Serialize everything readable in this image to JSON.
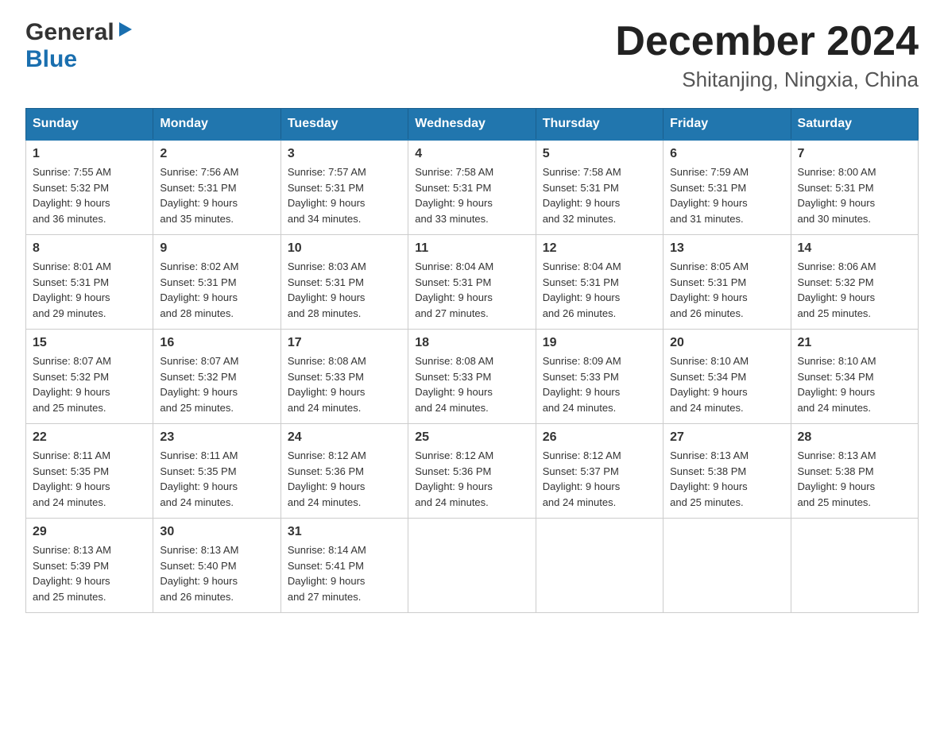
{
  "logo": {
    "general": "General",
    "blue": "Blue",
    "arrow": "▶"
  },
  "header": {
    "title": "December 2024",
    "subtitle": "Shitanjing, Ningxia, China"
  },
  "days": [
    "Sunday",
    "Monday",
    "Tuesday",
    "Wednesday",
    "Thursday",
    "Friday",
    "Saturday"
  ],
  "weeks": [
    [
      {
        "num": "1",
        "sunrise": "7:55 AM",
        "sunset": "5:32 PM",
        "daylight": "9 hours and 36 minutes."
      },
      {
        "num": "2",
        "sunrise": "7:56 AM",
        "sunset": "5:31 PM",
        "daylight": "9 hours and 35 minutes."
      },
      {
        "num": "3",
        "sunrise": "7:57 AM",
        "sunset": "5:31 PM",
        "daylight": "9 hours and 34 minutes."
      },
      {
        "num": "4",
        "sunrise": "7:58 AM",
        "sunset": "5:31 PM",
        "daylight": "9 hours and 33 minutes."
      },
      {
        "num": "5",
        "sunrise": "7:58 AM",
        "sunset": "5:31 PM",
        "daylight": "9 hours and 32 minutes."
      },
      {
        "num": "6",
        "sunrise": "7:59 AM",
        "sunset": "5:31 PM",
        "daylight": "9 hours and 31 minutes."
      },
      {
        "num": "7",
        "sunrise": "8:00 AM",
        "sunset": "5:31 PM",
        "daylight": "9 hours and 30 minutes."
      }
    ],
    [
      {
        "num": "8",
        "sunrise": "8:01 AM",
        "sunset": "5:31 PM",
        "daylight": "9 hours and 29 minutes."
      },
      {
        "num": "9",
        "sunrise": "8:02 AM",
        "sunset": "5:31 PM",
        "daylight": "9 hours and 28 minutes."
      },
      {
        "num": "10",
        "sunrise": "8:03 AM",
        "sunset": "5:31 PM",
        "daylight": "9 hours and 28 minutes."
      },
      {
        "num": "11",
        "sunrise": "8:04 AM",
        "sunset": "5:31 PM",
        "daylight": "9 hours and 27 minutes."
      },
      {
        "num": "12",
        "sunrise": "8:04 AM",
        "sunset": "5:31 PM",
        "daylight": "9 hours and 26 minutes."
      },
      {
        "num": "13",
        "sunrise": "8:05 AM",
        "sunset": "5:31 PM",
        "daylight": "9 hours and 26 minutes."
      },
      {
        "num": "14",
        "sunrise": "8:06 AM",
        "sunset": "5:32 PM",
        "daylight": "9 hours and 25 minutes."
      }
    ],
    [
      {
        "num": "15",
        "sunrise": "8:07 AM",
        "sunset": "5:32 PM",
        "daylight": "9 hours and 25 minutes."
      },
      {
        "num": "16",
        "sunrise": "8:07 AM",
        "sunset": "5:32 PM",
        "daylight": "9 hours and 25 minutes."
      },
      {
        "num": "17",
        "sunrise": "8:08 AM",
        "sunset": "5:33 PM",
        "daylight": "9 hours and 24 minutes."
      },
      {
        "num": "18",
        "sunrise": "8:08 AM",
        "sunset": "5:33 PM",
        "daylight": "9 hours and 24 minutes."
      },
      {
        "num": "19",
        "sunrise": "8:09 AM",
        "sunset": "5:33 PM",
        "daylight": "9 hours and 24 minutes."
      },
      {
        "num": "20",
        "sunrise": "8:10 AM",
        "sunset": "5:34 PM",
        "daylight": "9 hours and 24 minutes."
      },
      {
        "num": "21",
        "sunrise": "8:10 AM",
        "sunset": "5:34 PM",
        "daylight": "9 hours and 24 minutes."
      }
    ],
    [
      {
        "num": "22",
        "sunrise": "8:11 AM",
        "sunset": "5:35 PM",
        "daylight": "9 hours and 24 minutes."
      },
      {
        "num": "23",
        "sunrise": "8:11 AM",
        "sunset": "5:35 PM",
        "daylight": "9 hours and 24 minutes."
      },
      {
        "num": "24",
        "sunrise": "8:12 AM",
        "sunset": "5:36 PM",
        "daylight": "9 hours and 24 minutes."
      },
      {
        "num": "25",
        "sunrise": "8:12 AM",
        "sunset": "5:36 PM",
        "daylight": "9 hours and 24 minutes."
      },
      {
        "num": "26",
        "sunrise": "8:12 AM",
        "sunset": "5:37 PM",
        "daylight": "9 hours and 24 minutes."
      },
      {
        "num": "27",
        "sunrise": "8:13 AM",
        "sunset": "5:38 PM",
        "daylight": "9 hours and 25 minutes."
      },
      {
        "num": "28",
        "sunrise": "8:13 AM",
        "sunset": "5:38 PM",
        "daylight": "9 hours and 25 minutes."
      }
    ],
    [
      {
        "num": "29",
        "sunrise": "8:13 AM",
        "sunset": "5:39 PM",
        "daylight": "9 hours and 25 minutes."
      },
      {
        "num": "30",
        "sunrise": "8:13 AM",
        "sunset": "5:40 PM",
        "daylight": "9 hours and 26 minutes."
      },
      {
        "num": "31",
        "sunrise": "8:14 AM",
        "sunset": "5:41 PM",
        "daylight": "9 hours and 27 minutes."
      },
      null,
      null,
      null,
      null
    ]
  ],
  "labels": {
    "sunrise": "Sunrise:",
    "sunset": "Sunset:",
    "daylight": "Daylight:"
  }
}
